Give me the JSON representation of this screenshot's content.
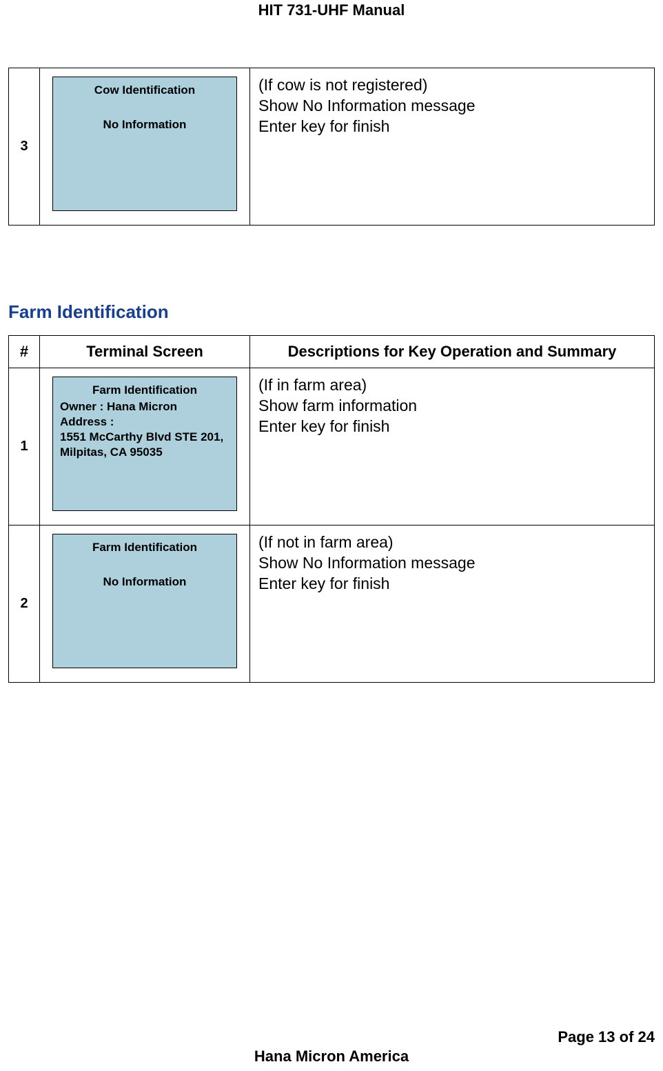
{
  "header": {
    "title": "HIT 731-UHF Manual"
  },
  "table1": {
    "rows": [
      {
        "num": "3",
        "screen": {
          "title": "Cow Identification",
          "message": "No Information"
        },
        "desc": "(If cow is not registered)\nShow No Information message\nEnter key for finish"
      }
    ]
  },
  "section": {
    "heading": "Farm Identification"
  },
  "table2": {
    "head": {
      "num": "#",
      "screen": "Terminal Screen",
      "desc": "Descriptions for Key Operation and Summary"
    },
    "rows": [
      {
        "num": "1",
        "screen": {
          "title": "Farm Identification",
          "body": "Owner : Hana Micron\nAddress :\n1551 McCarthy Blvd STE 201, Milpitas, CA 95035"
        },
        "desc": "(If in farm area)\nShow farm information\nEnter key for finish"
      },
      {
        "num": "2",
        "screen": {
          "title": "Farm Identification",
          "message": "No Information"
        },
        "desc": "(If not in farm area)\nShow No Information message\nEnter key for finish"
      }
    ]
  },
  "footer": {
    "page": "Page 13 of 24",
    "company": "Hana Micron America"
  }
}
